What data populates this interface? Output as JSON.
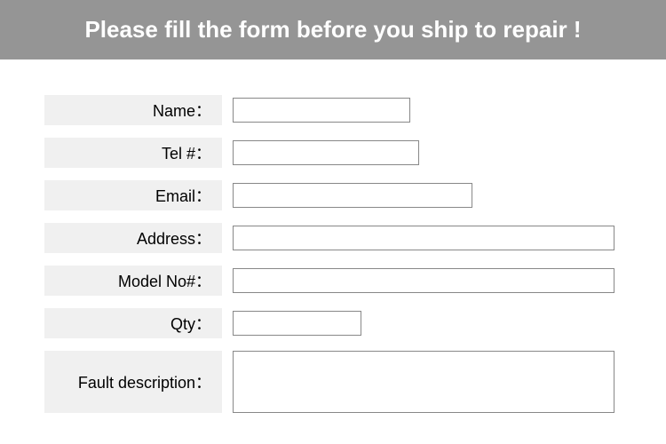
{
  "header": {
    "title": "Please fill the form before you ship to repair !"
  },
  "form": {
    "fields": {
      "name": {
        "label": "Name：",
        "value": ""
      },
      "tel": {
        "label": "Tel #：",
        "value": ""
      },
      "email": {
        "label": "Email：",
        "value": ""
      },
      "address": {
        "label": "Address：",
        "value": ""
      },
      "model": {
        "label": "Model No#：",
        "value": ""
      },
      "qty": {
        "label": "Qty：",
        "value": ""
      },
      "fault": {
        "label": "Fault description：",
        "value": ""
      }
    }
  }
}
